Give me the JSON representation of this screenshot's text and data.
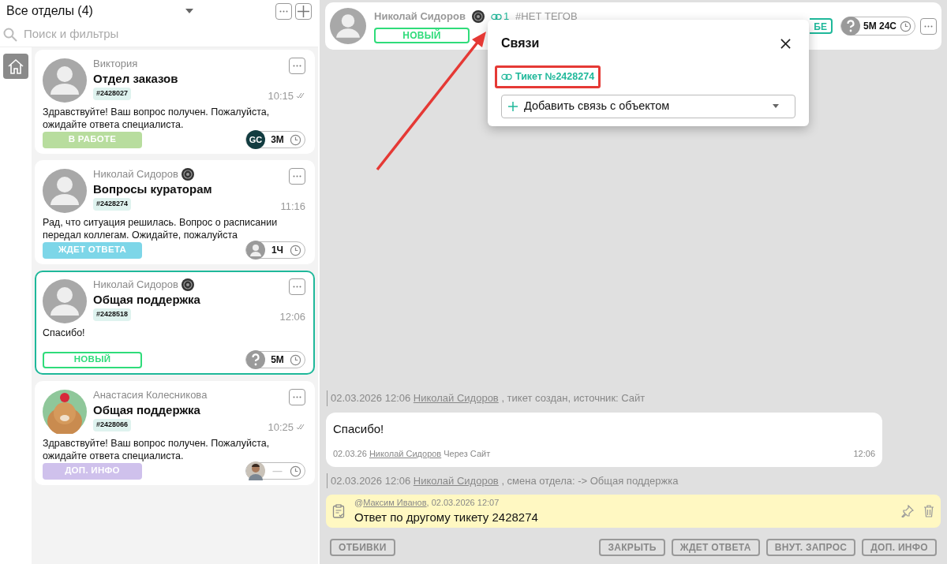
{
  "list_header": {
    "title": "Все отделы (4)"
  },
  "search": {
    "placeholder": "Поиск и фильтры"
  },
  "tickets": [
    {
      "author": "Виктория",
      "verified": false,
      "department": "Отдел заказов",
      "id": "#2428027",
      "time": "10:15",
      "read": true,
      "message": "Здравствуйте! Ваш вопрос получен. Пожалуйста, ожидайте ответа специалиста.",
      "kind": "placeholder",
      "status": {
        "label": "В РАБОТЕ",
        "kind": "filled",
        "color": "#b8dd9e"
      },
      "timer": {
        "kind": "logo",
        "logo_text": "GC",
        "value": "3М"
      },
      "selected": false
    },
    {
      "author": "Николай Сидоров",
      "verified": true,
      "department": "Вопросы кураторам",
      "id": "#2428274",
      "time": "11:16",
      "read": false,
      "message": "Рад, что ситуация решилась. Вопрос о расписании передал коллегам. Ожидайте, пожалуйста",
      "kind": "placeholder",
      "status": {
        "label": "ЖДЕТ ОТВЕТА",
        "kind": "filled",
        "color": "#7dd6e8"
      },
      "timer": {
        "kind": "person",
        "value": "1Ч"
      },
      "selected": false
    },
    {
      "author": "Николай Сидоров",
      "verified": true,
      "department": "Общая поддержка",
      "id": "#2428518",
      "time": "12:06",
      "read": false,
      "message": "Спасибо!",
      "kind": "placeholder",
      "status": {
        "label": "НОВЫЙ",
        "kind": "outline",
        "color": "#2fdc7a"
      },
      "timer": {
        "kind": "question",
        "value": "5М"
      },
      "selected": true
    },
    {
      "author": "Анастасия Колесникова",
      "verified": false,
      "department": "Общая поддержка",
      "id": "#2428066",
      "time": "10:25",
      "read": true,
      "message": "Здравствуйте! Ваш вопрос получен. Пожалуйста, ожидайте ответа специалиста.",
      "status": {
        "label": "ДОП. ИНФО",
        "kind": "filled",
        "color": "#cfc1ec"
      },
      "timer": {
        "value": "—"
      },
      "selected": false
    }
  ],
  "header": {
    "author": "Николай Сидоров",
    "verified": true,
    "links_count": "1",
    "tags": "#НЕТ ТЕГОВ",
    "status": "НОВЫЙ",
    "partial_button": "БЕ",
    "timer": "5М 24С"
  },
  "popup": {
    "title": "Связи",
    "links": [
      {
        "label": "Тикет №2428274",
        "highlighted": true
      }
    ],
    "add_select": "Добавить связь с объектом"
  },
  "feed": [
    {
      "kind": "system",
      "date": "02.03.2026 12:06",
      "user": "Николай Сидоров",
      "text": ", тикет создан, источник: Сайт"
    },
    {
      "kind": "message",
      "text": "Спасибо!",
      "date": "02.03.26",
      "user": "Николай Сидоров",
      "via": "Через Сайт",
      "time": "12:06"
    },
    {
      "kind": "system",
      "date": "02.03.2026 12:06",
      "user": "Николай Сидоров",
      "text": ", смена отдела: -> Общая поддержка"
    },
    {
      "kind": "note",
      "prefix": "@",
      "user": "Максим Иванов",
      "meta": ", 02.03.2026 12:07",
      "text": "Ответ по другому тикету 2428274"
    }
  ],
  "actions_left": [
    "ОТБИВКИ"
  ],
  "actions_right": [
    "ЗАКРЫТЬ",
    "ЖДЕТ ОТВЕТА",
    "ВНУТ. ЗАПРОС",
    "ДОП. ИНФО"
  ]
}
